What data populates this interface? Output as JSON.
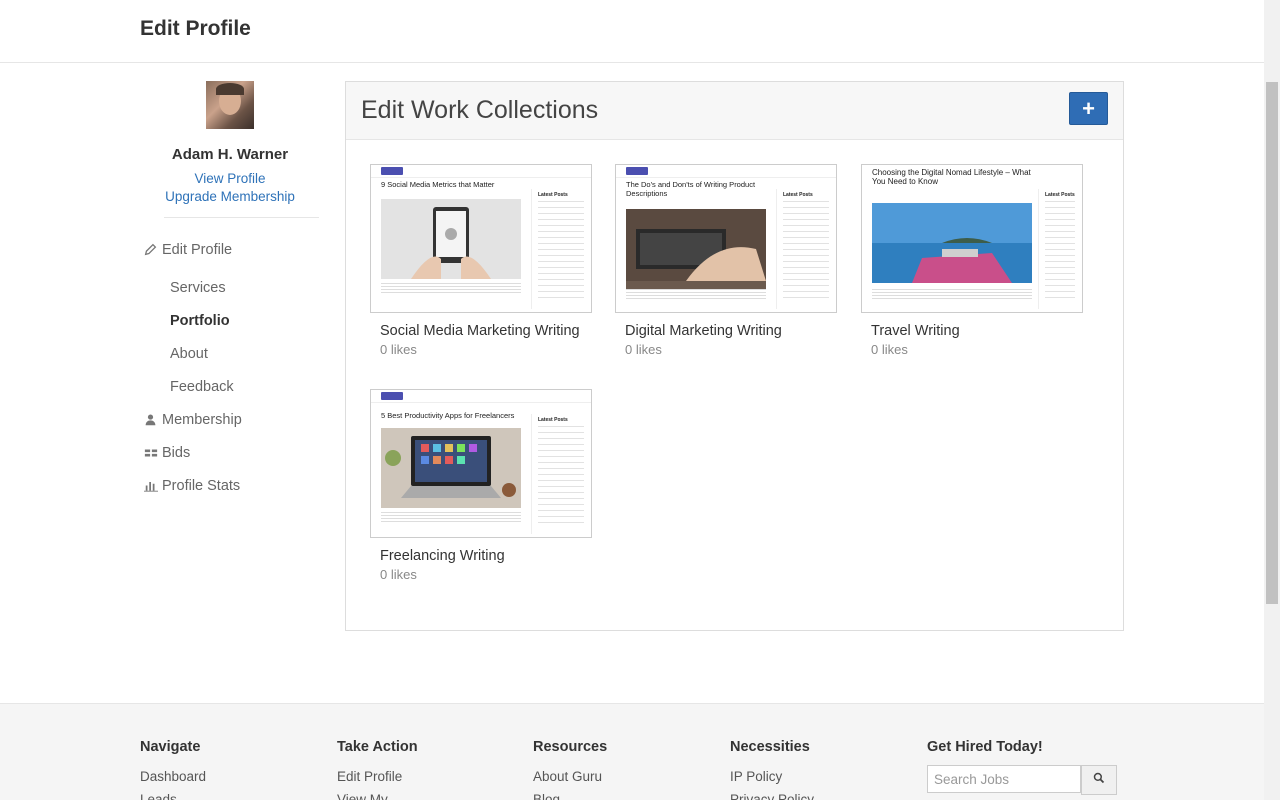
{
  "header": {
    "title": "Edit Profile"
  },
  "sidebar": {
    "user_name": "Adam H. Warner",
    "view_profile": "View Profile",
    "upgrade": "Upgrade Membership",
    "nav": {
      "edit_profile": "Edit Profile",
      "services": "Services",
      "portfolio": "Portfolio",
      "about": "About",
      "feedback": "Feedback",
      "membership": "Membership",
      "bids": "Bids",
      "profile_stats": "Profile Stats"
    }
  },
  "main": {
    "title": "Edit Work Collections",
    "add_label": "+",
    "collections": [
      {
        "title": "Social Media Marketing Writing",
        "likes": "0 likes",
        "thumb_title": "9 Social Media Metrics that Matter",
        "thumb_color": "#d9d9d9"
      },
      {
        "title": "Digital Marketing Writing",
        "likes": "0 likes",
        "thumb_title": "The Do's and Don'ts of Writing Product Descriptions",
        "thumb_color": "#5a4a40"
      },
      {
        "title": "Travel Writing",
        "likes": "0 likes",
        "thumb_title": "Choosing the Digital Nomad Lifestyle – What You Need to Know",
        "thumb_color": "#3f86c4"
      },
      {
        "title": "Freelancing Writing",
        "likes": "0 likes",
        "thumb_title": "5 Best Productivity Apps for Freelancers",
        "thumb_color": "#2b2b2b"
      }
    ],
    "thumb_sidebar_title": "Latest Posts"
  },
  "footer": {
    "columns": [
      {
        "heading": "Navigate",
        "link": "Dashboard",
        "cut": "Leads"
      },
      {
        "heading": "Take Action",
        "link": "Edit Profile",
        "cut": "View My"
      },
      {
        "heading": "Resources",
        "link": "About Guru",
        "cut": "Blog"
      },
      {
        "heading": "Necessities",
        "link": "IP Policy",
        "cut": "Privacy Policy"
      }
    ],
    "hired": {
      "heading": "Get Hired Today!",
      "search_placeholder": "Search Jobs"
    }
  },
  "colors": {
    "accent": "#2f6db5",
    "link": "#2e72b8"
  }
}
